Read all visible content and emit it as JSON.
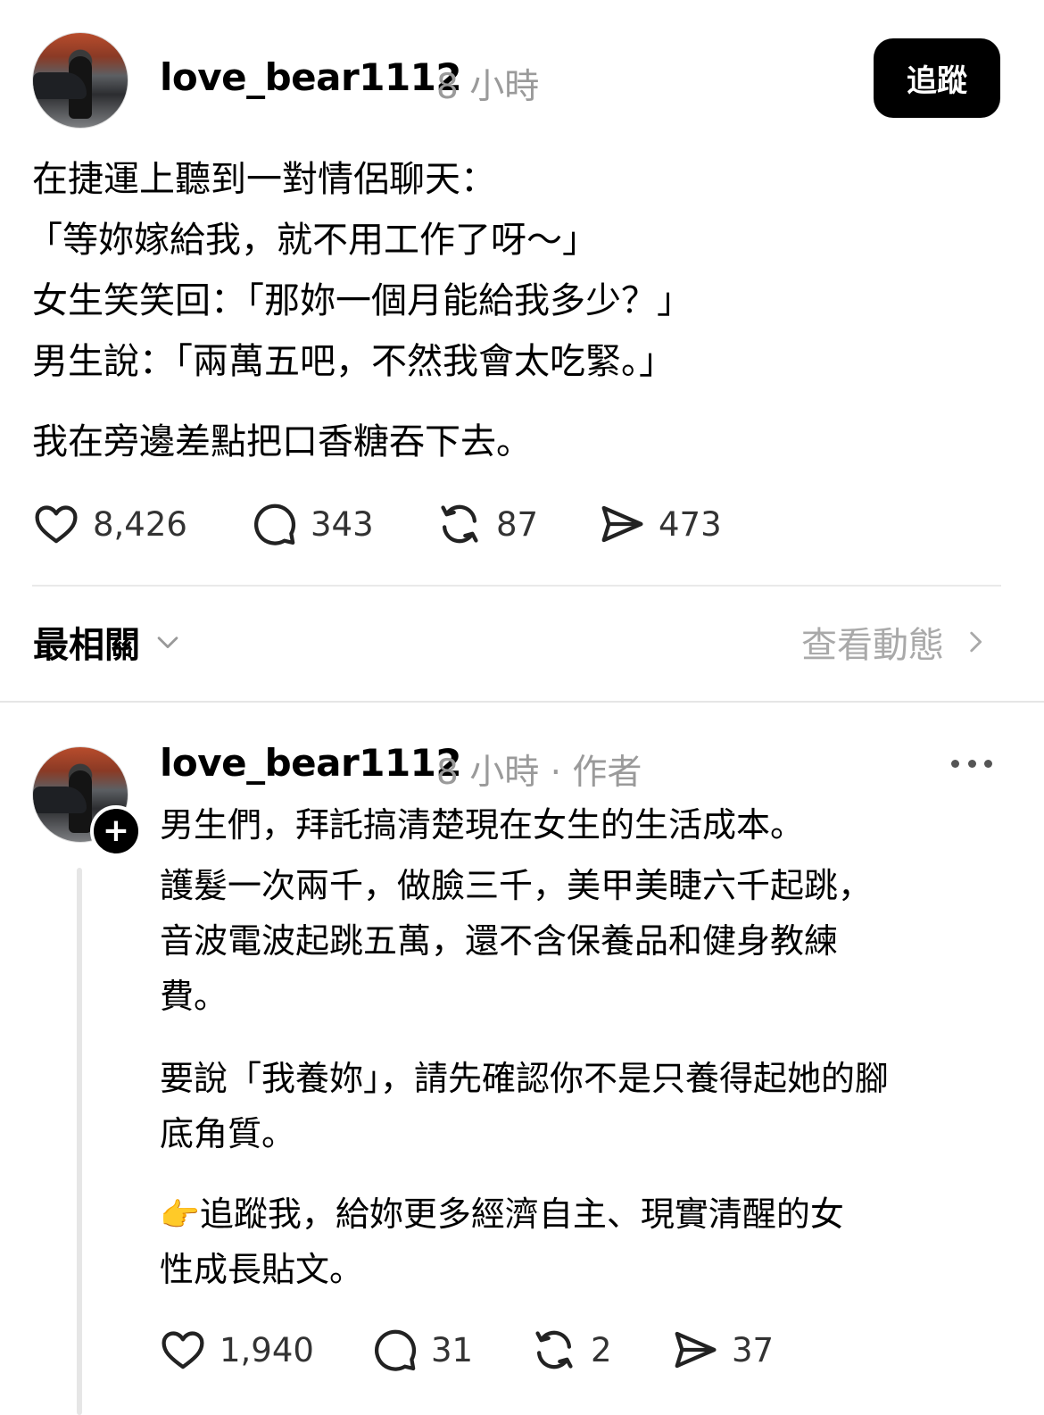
{
  "post": {
    "username": "love_bear1112",
    "time": "8 小時",
    "follow_label": "追蹤",
    "lines": [
      "在捷運上聽到一對情侶聊天：",
      "「等妳嫁給我，就不用工作了呀～」",
      "女生笑笑回：「那妳一個月能給我多少？」",
      "男生說：「兩萬五吧，不然我會太吃緊。」",
      "我在旁邊差點把口香糖吞下去。"
    ],
    "likes": "8,426",
    "comments": "343",
    "reposts": "87",
    "shares": "473"
  },
  "sort": {
    "label": "最相關",
    "activity_label": "查看動態"
  },
  "reply": {
    "username": "love_bear1112",
    "meta": "8 小時 · 作者",
    "lines": [
      "男生們，拜託搞清楚現在女生的生活成本。",
      "護髮一次兩千，做臉三千，美甲美睫六千起跳，",
      "音波電波起跳五萬，還不含保養品和健身教練",
      "費。",
      "要說「我養妳」，請先確認你不是只養得起她的腳",
      "底角質。",
      "追蹤我，給妳更多經濟自主、現實清醒的女",
      "性成長貼文。"
    ],
    "emoji": "👉",
    "likes": "1,940",
    "comments": "31",
    "reposts": "2",
    "shares": "37"
  },
  "icons": [
    "heart-icon",
    "comment-icon",
    "repost-icon",
    "share-icon",
    "chevron-down-icon",
    "chevron-right-icon",
    "more-icon",
    "plus-icon"
  ]
}
